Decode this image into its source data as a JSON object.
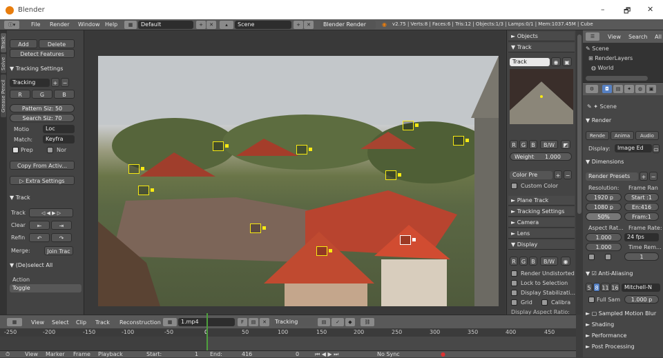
{
  "window": {
    "title": "Blender",
    "min": "–",
    "max": "🗗",
    "close": "✕"
  },
  "topbar": {
    "menus": [
      "File",
      "Render",
      "Window",
      "Help"
    ],
    "layout": "Default",
    "scene": "Scene",
    "engine": "Blender Render",
    "stats": "v2.75 | Verts:8 | Faces:6 | Tris:12 | Objects:1/3 | Lamps:0/1 | Mem:1037.45M | Cube"
  },
  "tabs": [
    "Track",
    "Solve",
    "Grease Pencil"
  ],
  "left": {
    "add": "Add",
    "delete": "Delete",
    "detect": "Detect Features",
    "tracking_settings": "Tracking Settings",
    "tracking": "Tracking",
    "r": "R",
    "g": "G",
    "b": "B",
    "pattern": "Pattern Siz: 50",
    "search": "Search Siz: 70",
    "motion_lbl": "Motio",
    "motion_val": "Loc",
    "match_lbl": "Match:",
    "match_val": "Keyfra",
    "prep": "Prep",
    "nor": "Nor",
    "copy": "Copy From Activ...",
    "extra": "Extra Settings",
    "track_hdr": "Track",
    "track_lbl": "Track",
    "clear_lbl": "Clear",
    "refine_lbl": "Refin",
    "merge_lbl": "Merge:",
    "join": "Join Trac",
    "deselect": "(De)select All",
    "action": "Action",
    "toggle": "Toggle"
  },
  "right": {
    "objects": "Objects",
    "track": "Track",
    "track_field": "Track",
    "r": "R",
    "g": "G",
    "b": "B",
    "bw": "B/W",
    "weight": "Weight:",
    "weight_val": "1.000",
    "color_pre": "Color Pre",
    "custom_color": "Custom Color",
    "plane_track": "Plane Track",
    "tracking_settings": "Tracking Settings",
    "camera": "Camera",
    "lens": "Lens",
    "display": "Display",
    "render_undistorted": "Render Undistorted",
    "lock_to_selection": "Lock to Selection",
    "display_stab": "Display Stabilizati...",
    "grid": "Grid",
    "calibra": "Calibra",
    "aspect": "Display Aspect Ratio:"
  },
  "outliner": {
    "view": "View",
    "search": "Search",
    "all": "All",
    "items": [
      "Scene",
      "RenderLayers",
      "World"
    ]
  },
  "props": {
    "scene": "Scene",
    "render": "Render",
    "render_btn": "Rende",
    "anim_btn": "Anima",
    "audio_btn": "Audio",
    "display_lbl": "Display:",
    "display_val": "Image Ed",
    "dimensions": "Dimensions",
    "presets": "Render Presets",
    "resolution": "Resolution:",
    "frame_range": "Frame Ran",
    "res_x": "1920 p",
    "res_y": "1080 p",
    "res_pct": "50%",
    "start": "Start :1",
    "end": "En:416",
    "frame": "Fram:1",
    "aspect": "Aspect Rat...",
    "frame_rate": "Frame Rate:",
    "asp_x": "1.000",
    "asp_y": "1.000",
    "fps": "24 fps",
    "time_rem": "Time Rem...",
    "step": "1",
    "aa": "Anti-Aliasing",
    "aa5": "5",
    "aa8": "8",
    "aa11": "11",
    "aa16": "16",
    "mitchell": "Mitchell-N",
    "full_sam": "Full Sam",
    "full_val": "1.000 p",
    "motion_blur": "Sampled Motion Blur",
    "shading": "Shading",
    "performance": "Performance",
    "post": "Post Processing"
  },
  "clipheader": {
    "view": "View",
    "select": "Select",
    "clip": "Clip",
    "track": "Track",
    "recon": "Reconstruction",
    "clip_name": "1.mp4",
    "f": "F",
    "mode": "Tracking"
  },
  "ruler": [
    "-250",
    "-200",
    "-150",
    "-100",
    "-50",
    "0",
    "50",
    "100",
    "150",
    "200",
    "250",
    "300",
    "350",
    "400",
    "450"
  ],
  "timeline": {
    "view": "View",
    "marker": "Marker",
    "frame": "Frame",
    "playback": "Playback",
    "start": "Start:",
    "start_val": "1",
    "end": "End:",
    "end_val": "416",
    "cur": "0",
    "sync": "No Sync"
  },
  "colors": {
    "marker": "#f8ea12",
    "accent": "#5680c2",
    "playhead": "#4ea03d"
  }
}
